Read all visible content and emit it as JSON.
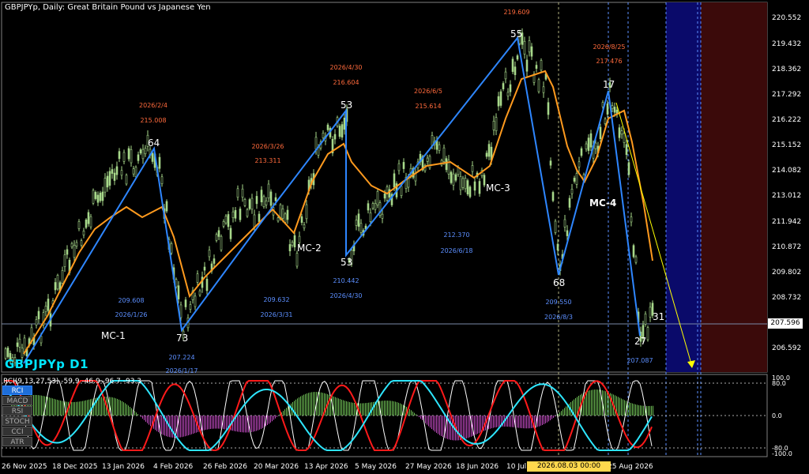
{
  "header": {
    "title": "GBPJPYp, Daily:  Great Britain Pound vs Japanese Yen",
    "symbol_label": "GBPJPYp D1",
    "indicator_label": "RCI(9,13,27,53) -59.9 -46.9 -96.7 -93.3"
  },
  "indicator_buttons": [
    {
      "label": "RCI",
      "active": true
    },
    {
      "label": "MACD",
      "active": false
    },
    {
      "label": "RSI",
      "active": false
    },
    {
      "label": "STOCH",
      "active": false
    },
    {
      "label": "CCI",
      "active": false
    },
    {
      "label": "ATR",
      "active": false
    }
  ],
  "price_axis": {
    "ticks": [
      "220.552",
      "219.432",
      "218.362",
      "217.292",
      "216.222",
      "215.152",
      "214.082",
      "213.012",
      "211.942",
      "210.872",
      "209.802",
      "208.732",
      "207.596",
      "206.592"
    ],
    "current_price": "207.596"
  },
  "indicator_axis": {
    "ticks": [
      "100.0",
      "80.0",
      "0.0",
      "-80.0",
      "-100.0"
    ]
  },
  "time_axis": {
    "ticks": [
      "26 Nov 2025",
      "18 Dec 2025",
      "13 Jan 2026",
      "4 Feb 2026",
      "26 Feb 2026",
      "20 Mar 2026",
      "13 Apr 2026",
      "5 May 2026",
      "27 May 2026",
      "18 Jun 2026",
      "10 Jul",
      "25 Aug 2026"
    ],
    "cursor_date": "2026.08.03 00:00"
  },
  "waves": [
    {
      "label": "MC-1"
    },
    {
      "label": "MC-2"
    },
    {
      "label": "MC-3"
    },
    {
      "label": "MC-4"
    }
  ],
  "swing_counts": [
    "64",
    "73",
    "53",
    "53",
    "55",
    "68",
    "17",
    "27",
    "31"
  ],
  "pivot_labels_high": [
    {
      "date": "2026/2/4",
      "price": "215.008"
    },
    {
      "date": "2026/3/26",
      "price": "213.311"
    },
    {
      "date": "2026/4/30",
      "price": "216.604"
    },
    {
      "date": "2026/6/5",
      "price": "215.614"
    },
    {
      "date": "",
      "price": "219.609"
    },
    {
      "date": "2026/8/25",
      "price": "217.476"
    }
  ],
  "pivot_labels_low": [
    {
      "date": "2026/1/26",
      "price": "209.608"
    },
    {
      "date": "2026/1/17",
      "price": "207.224"
    },
    {
      "date": "2026/3/31",
      "price": "209.632"
    },
    {
      "date": "2026/4/30",
      "price": "210.442"
    },
    {
      "date": "2026/6/18",
      "price": "212.370"
    },
    {
      "date": "2026/8/3",
      "price": "209.550"
    },
    {
      "date": "",
      "price": "207.087"
    }
  ],
  "colors": {
    "background": "#000000",
    "candle": "#a7d88a",
    "ma": "#ff9a1e",
    "zigzag": "#2e86ff",
    "pivot_high": "#ff6a3c",
    "pivot_low": "#5c8fff",
    "rci_white": "#ffffff",
    "rci_red": "#ff1a1a",
    "rci_cyan": "#2ee6ff",
    "hist_green": "#6fbf55",
    "hist_magenta": "#c04ac0",
    "forecast_arrow": "#ffff00",
    "zone_blue": "#0a0a6a",
    "zone_red": "#3b0a0a"
  }
}
